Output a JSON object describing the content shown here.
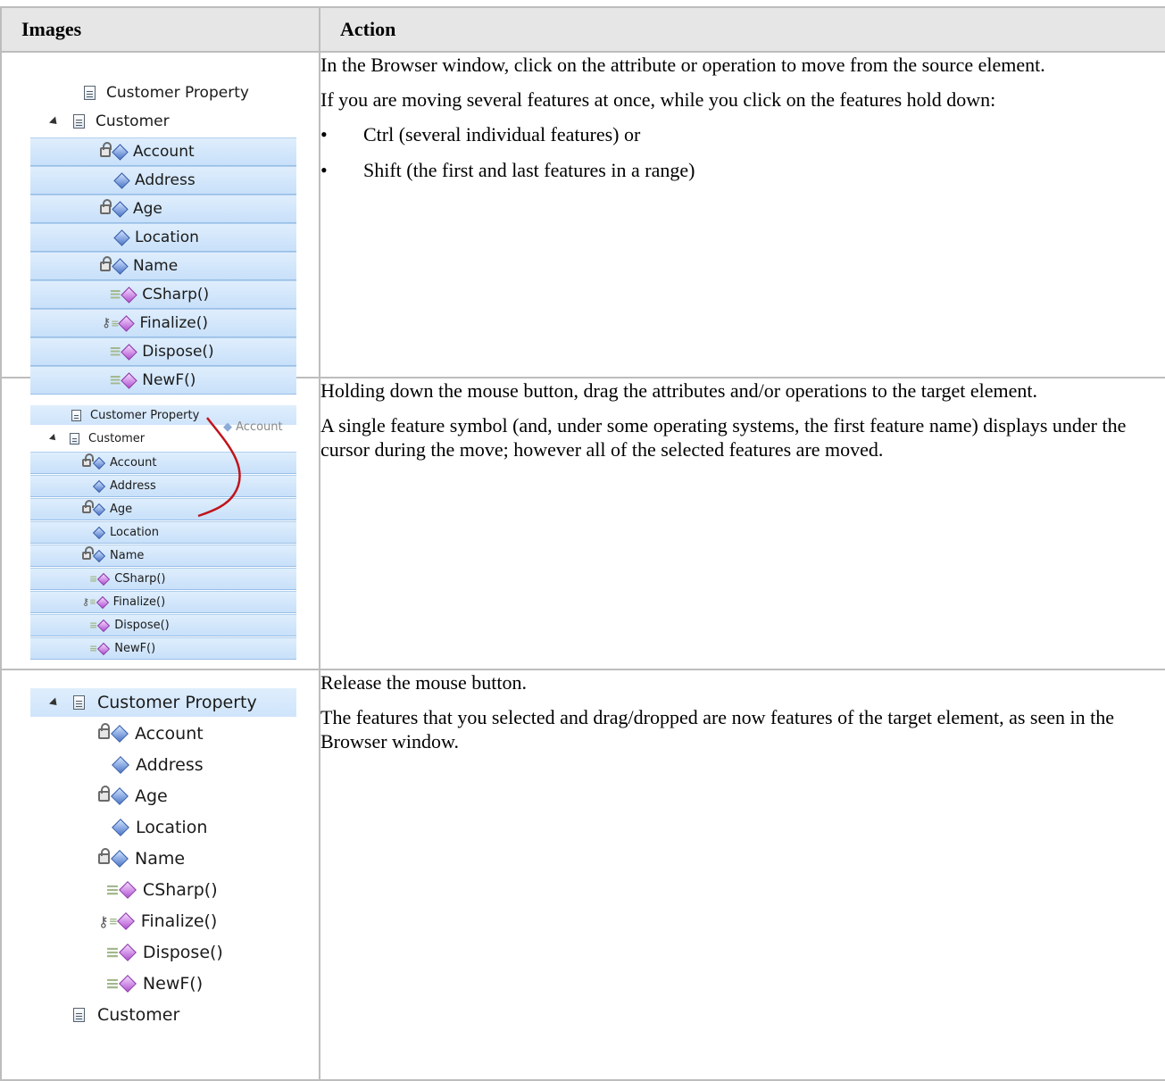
{
  "table": {
    "headers": {
      "images": "Images",
      "action": "Action"
    }
  },
  "rows": [
    {
      "tree": {
        "parent_above": "Customer Property",
        "parent": "Customer",
        "items": [
          "Account",
          "Address",
          "Age",
          "Location",
          "Name",
          "CSharp()",
          "Finalize()",
          "Dispose()",
          "NewF()"
        ]
      },
      "action": {
        "p1": "In the Browser window, click on the attribute or operation to move from the source element.",
        "p2": "If you are moving several features at once, while you click on the features hold down:",
        "bullets": [
          "Ctrl (several individual features) or",
          "Shift (the first and last features in a range)"
        ]
      }
    },
    {
      "tree": {
        "target": "Customer Property",
        "drag_ghost": "Account",
        "parent": "Customer",
        "items": [
          "Account",
          "Address",
          "Age",
          "Location",
          "Name",
          "CSharp()",
          "Finalize()",
          "Dispose()",
          "NewF()"
        ]
      },
      "action": {
        "p1": "Holding down the mouse button, drag the attributes and/or operations to the target element.",
        "p2": "A single feature symbol (and, under some operating systems, the first feature name) displays under the cursor during the move; however all of the selected features are moved."
      }
    },
    {
      "tree": {
        "target": "Customer Property",
        "items": [
          "Account",
          "Address",
          "Age",
          "Location",
          "Name",
          "CSharp()",
          "Finalize()",
          "Dispose()",
          "NewF()"
        ],
        "after": "Customer"
      },
      "action": {
        "p1": "Release the mouse button.",
        "p2": "The features that you selected and drag/dropped are now features of the target element, as seen in the Browser window."
      }
    }
  ],
  "colors": {
    "selection": "#c8e0fa",
    "drag_path": "#c0141c",
    "header_bg": "#e6e6e6",
    "border": "#bdbdbd"
  }
}
